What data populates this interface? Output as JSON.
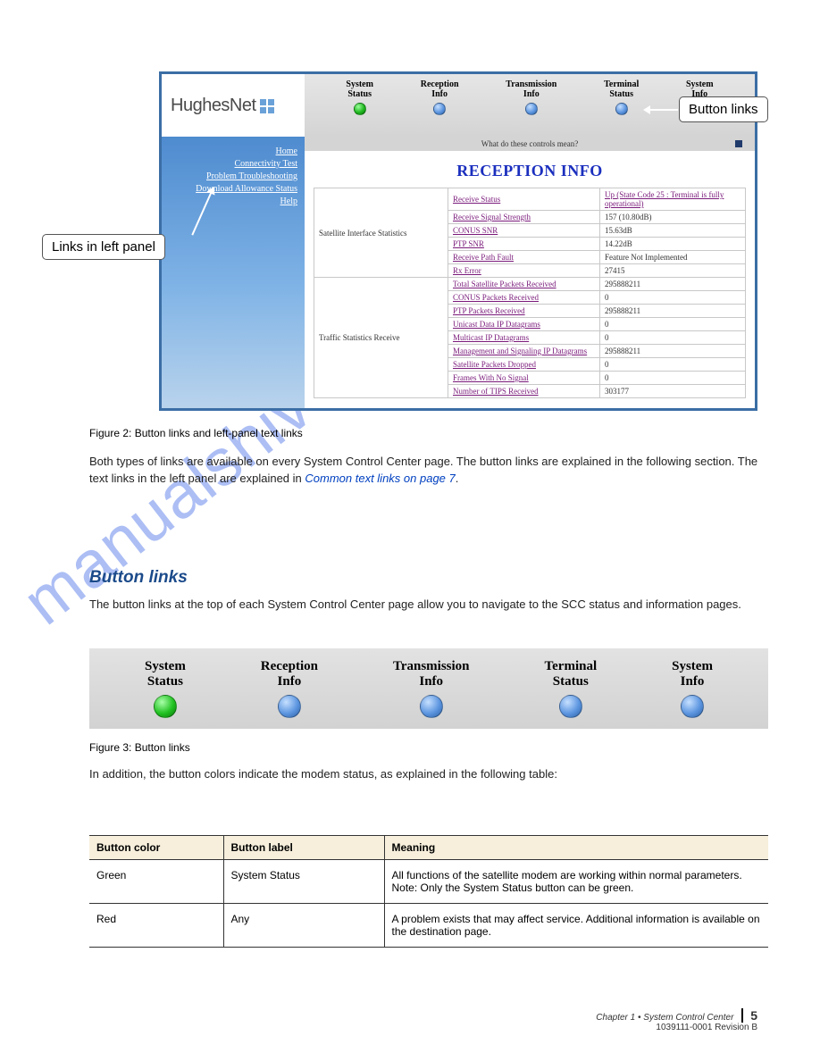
{
  "watermark": "manualshive.com",
  "app": {
    "logo": "HughesNet",
    "topButtons": [
      {
        "line1": "System",
        "line2": "Status",
        "color": "green"
      },
      {
        "line1": "Reception",
        "line2": "Info",
        "color": "blue"
      },
      {
        "line1": "Transmission",
        "line2": "Info",
        "color": "blue"
      },
      {
        "line1": "Terminal",
        "line2": "Status",
        "color": "blue"
      },
      {
        "line1": "System",
        "line2": "Info",
        "color": "blue"
      }
    ],
    "controlsStrip": "What do these controls mean?",
    "leftLinks": [
      "Home",
      "Connectivity Test",
      "Problem Troubleshooting",
      "Download Allowance Status",
      "Help"
    ],
    "pageTitle": "RECEPTION INFO",
    "groups": [
      {
        "name": "Satellite Interface Statistics",
        "rows": [
          {
            "metric": "Receive Status",
            "value": "Up (State Code 25 : Terminal is fully operational)",
            "valueIsLink": true
          },
          {
            "metric": "Receive Signal Strength",
            "value": "157 (10.80dB)"
          },
          {
            "metric": "CONUS SNR",
            "value": "15.63dB"
          },
          {
            "metric": "PTP SNR",
            "value": "14.22dB"
          },
          {
            "metric": "Receive Path Fault",
            "value": "Feature Not Implemented"
          },
          {
            "metric": "Rx Error",
            "value": "27415"
          }
        ]
      },
      {
        "name": "Traffic Statistics Receive",
        "rows": [
          {
            "metric": "Total Satellite Packets Received",
            "value": "295888211"
          },
          {
            "metric": "CONUS Packets Received",
            "value": "0"
          },
          {
            "metric": "PTP Packets Received",
            "value": "295888211"
          },
          {
            "metric": "Unicast Data IP Datagrams",
            "value": "0"
          },
          {
            "metric": "Multicast IP Datagrams",
            "value": "0"
          },
          {
            "metric": "Management and Signaling IP Datagrams",
            "value": "295888211"
          },
          {
            "metric": "Satellite Packets Dropped",
            "value": "0"
          },
          {
            "metric": "Frames With No Signal",
            "value": "0"
          },
          {
            "metric": "Number of TIPS Received",
            "value": "303177"
          }
        ]
      }
    ]
  },
  "callouts": {
    "buttons": "Button links",
    "left": "Links in left panel"
  },
  "figCaption1": "Figure 2: Button links and left-panel text links",
  "para1a": "Both types of links are available on every System Control Center page. The button links are explained in the following section. The text links in the left panel are explained in ",
  "para1link": "Common text links on page 7",
  "para1b": ".",
  "subheadButtons": "Button links",
  "para2": "The button links at the top of each System Control Center page allow you to navigate to the SCC status and information pages.",
  "bigButtons": [
    {
      "line1": "System",
      "line2": "Status",
      "color": "green"
    },
    {
      "line1": "Reception",
      "line2": "Info",
      "color": "blue"
    },
    {
      "line1": "Transmission",
      "line2": "Info",
      "color": "blue"
    },
    {
      "line1": "Terminal",
      "line2": "Status",
      "color": "blue"
    },
    {
      "line1": "System",
      "line2": "Info",
      "color": "blue"
    }
  ],
  "figCaption2": "Figure 3: Button links",
  "para3": "In addition, the button colors indicate the modem status, as explained in the following table:",
  "colorsTable": {
    "headers": [
      "Button color",
      "Button label",
      "Meaning"
    ],
    "rows": [
      {
        "color": "Green",
        "label": "System Status",
        "meaning": "All functions of the satellite modem are working within normal parameters. Note: Only the System Status button can be green."
      },
      {
        "color": "Red",
        "label": "Any",
        "meaning": "A problem exists that may affect service. Additional information is available on the destination page."
      }
    ]
  },
  "footer": {
    "chapter": "Chapter 1  •  System Control Center",
    "page": "5",
    "sub": "1039111-0001 Revision B"
  }
}
